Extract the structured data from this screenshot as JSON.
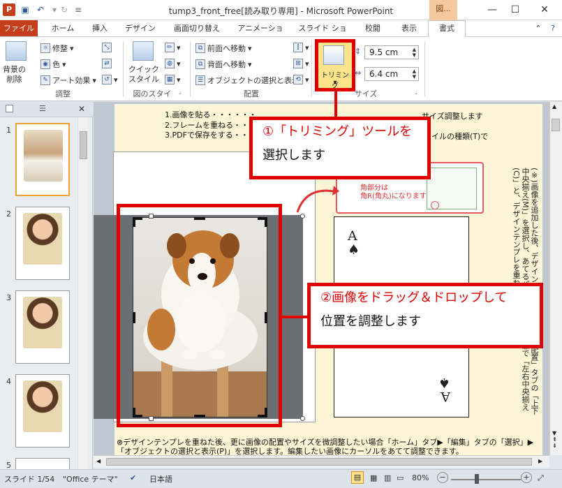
{
  "window": {
    "title": "tump3_front_free[読み取り専用] - Microsoft PowerPoint",
    "app_icon": "P",
    "context_tab_label": "図...",
    "minimize": "—",
    "maximize": "☐",
    "close": "✕"
  },
  "qat": {
    "save_icon": "save-icon",
    "undo_icon": "undo-icon",
    "redo_icon": "redo-icon"
  },
  "tabs": [
    {
      "label": "ファイル"
    },
    {
      "label": "ホーム"
    },
    {
      "label": "挿入"
    },
    {
      "label": "デザイン"
    },
    {
      "label": "画面切り替え"
    },
    {
      "label": "アニメーション"
    },
    {
      "label": "スライド ショー"
    },
    {
      "label": "校閲"
    },
    {
      "label": "表示"
    },
    {
      "label": "書式"
    }
  ],
  "ribbon": {
    "remove_bg": {
      "line1": "背景の",
      "line2": "削除"
    },
    "correct": "修整",
    "color": "色",
    "art_effect": "アート効果",
    "adjust_group": "調整",
    "quick_style": {
      "line1": "クイック",
      "line2": "スタイル"
    },
    "picture_style_group": "図のスタイル",
    "bring_forward": "前面へ移動",
    "send_backward": "背面へ移動",
    "selection_pane": "オブジェクトの選択と表示",
    "arrange_group": "配置",
    "crop": "トリミング",
    "height": "9.5 cm",
    "width": "6.4 cm",
    "size_group": "サイズ"
  },
  "slides_pane": {
    "numbers": [
      "1",
      "2",
      "3",
      "4",
      "5"
    ],
    "close": "✕"
  },
  "slide": {
    "instructions": "1.画像を貼る・・・・・・\n2.フレームを重ねる・・・\n3.PDFで保存をする・・",
    "instructions_tail_1": "サイズ調整します",
    "instructions_tail_3": "イルの種類(T)で",
    "sample_note": "角部分は\n角R(角丸)になります↘",
    "card_rank": "A",
    "card_suit": "♠",
    "side_note": "(※)画像を追加した後、デザイン「書式」タブ▼「配置」タブの「上下中央揃え(M)」を選択し、あてるパネルをあてた状態で「左右中央揃え(C)」と、デザインテンプレを重ねなください。",
    "bottom_text": "⊗デザインテンプレを重ねた後、更に画像の配置やサイズを微調整したい場合「ホーム」タブ▶「編集」タブの「選択」▶「オブジェクトの選択と表示(P)」を選択します。編集したい画像にカーソルをあてて調整できます。"
  },
  "callouts": {
    "one_line1": "①「トリミング」ツールを",
    "one_line2": "選択します",
    "two_line1": "②画像をドラッグ＆ドロップして",
    "two_line2": "位置を調整します"
  },
  "status": {
    "slide": "スライド 1/54",
    "theme": "\"Office テーマ\"",
    "language": "日本語",
    "zoom": "80%"
  },
  "colors": {
    "accent": "#c43e1c",
    "highlight_red": "#e00000",
    "crop_yellow": "#fde48a"
  }
}
